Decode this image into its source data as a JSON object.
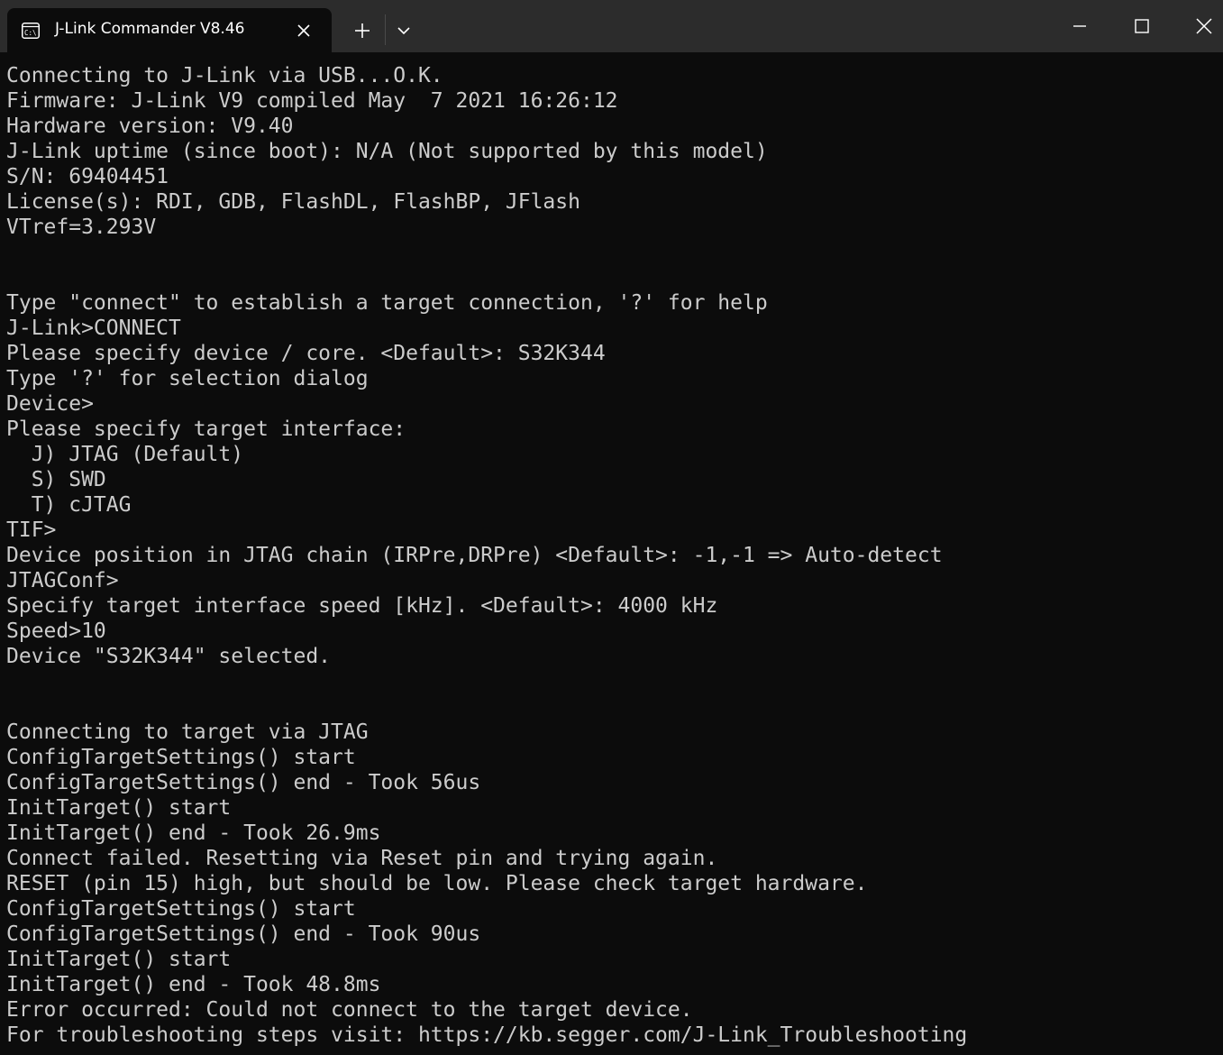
{
  "window": {
    "tab_title": "J-Link Commander V8.46",
    "tab_icon": "terminal-icon"
  },
  "terminal": {
    "lines": [
      "Connecting to J-Link via USB...O.K.",
      "Firmware: J-Link V9 compiled May  7 2021 16:26:12",
      "Hardware version: V9.40",
      "J-Link uptime (since boot): N/A (Not supported by this model)",
      "S/N: 69404451",
      "License(s): RDI, GDB, FlashDL, FlashBP, JFlash",
      "VTref=3.293V",
      "",
      "",
      "Type \"connect\" to establish a target connection, '?' for help",
      "J-Link>CONNECT",
      "Please specify device / core. <Default>: S32K344",
      "Type '?' for selection dialog",
      "Device>",
      "Please specify target interface:",
      "  J) JTAG (Default)",
      "  S) SWD",
      "  T) cJTAG",
      "TIF>",
      "Device position in JTAG chain (IRPre,DRPre) <Default>: -1,-1 => Auto-detect",
      "JTAGConf>",
      "Specify target interface speed [kHz]. <Default>: 4000 kHz",
      "Speed>10",
      "Device \"S32K344\" selected.",
      "",
      "",
      "Connecting to target via JTAG",
      "ConfigTargetSettings() start",
      "ConfigTargetSettings() end - Took 56us",
      "InitTarget() start",
      "InitTarget() end - Took 26.9ms",
      "Connect failed. Resetting via Reset pin and trying again.",
      "RESET (pin 15) high, but should be low. Please check target hardware.",
      "ConfigTargetSettings() start",
      "ConfigTargetSettings() end - Took 90us",
      "InitTarget() start",
      "InitTarget() end - Took 48.8ms",
      "Error occurred: Could not connect to the target device.",
      "For troubleshooting steps visit: https://kb.segger.com/J-Link_Troubleshooting"
    ]
  },
  "colors": {
    "background": "#0c0c0c",
    "titlebar": "#2c2c2c",
    "text": "#cccccc"
  }
}
